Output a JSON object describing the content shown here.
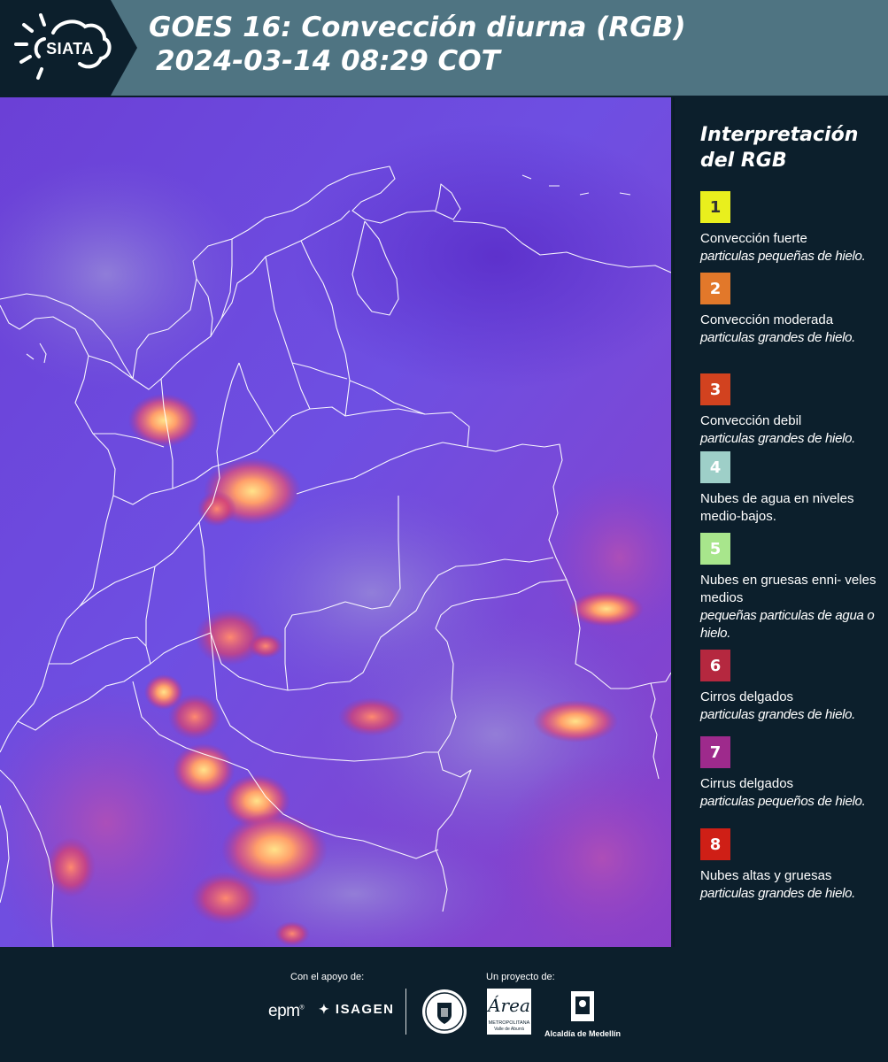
{
  "header": {
    "logo_text": "SIATA",
    "title_line1": "GOES 16: Convección diurna (RGB)",
    "title_line2": "2024-03-14 08:29 COT",
    "background_color": "#4f7482"
  },
  "map": {
    "description_icon": "satellite-rgb-map",
    "base_color": "#6a45d8"
  },
  "legend": {
    "title": "Interpretación del RGB",
    "items": [
      {
        "number": "1",
        "color": "#e9ef1d",
        "text_color": "#333333",
        "main": "Convección fuerte",
        "sub": "particulas pequeñas de hielo."
      },
      {
        "number": "2",
        "color": "#e2782a",
        "text_color": "#ffffff",
        "main": "Convección moderada",
        "sub": "particulas grandes de hielo."
      },
      {
        "number": "3",
        "color": "#d2421f",
        "text_color": "#ffffff",
        "main": "Convección debil",
        "sub": "particulas grandes de hielo."
      },
      {
        "number": "4",
        "color": "#9ecfc8",
        "text_color": "#ffffff",
        "main": "Nubes de agua en niveles medio-bajos.",
        "sub": ""
      },
      {
        "number": "5",
        "color": "#a8e68c",
        "text_color": "#ffffff",
        "main": "Nubes en gruesas enni- veles medios",
        "sub": "pequeñas particulas de agua o hielo."
      },
      {
        "number": "6",
        "color": "#b5283f",
        "text_color": "#ffffff",
        "main": "Cirros delgados",
        "sub": "particulas grandes de hielo."
      },
      {
        "number": "7",
        "color": "#9e2a8c",
        "text_color": "#ffffff",
        "main": "Cirrus delgados",
        "sub": "particulas pequeños de hielo."
      },
      {
        "number": "8",
        "color": "#cf1f16",
        "text_color": "#ffffff",
        "main": "Nubes altas y gruesas",
        "sub": "particulas grandes de hielo."
      }
    ]
  },
  "footer": {
    "support_label": "Con el apoyo de:",
    "project_label": "Un proyecto de:",
    "epm": "epm",
    "isagen": "ISAGEN",
    "area_text": "Área",
    "area_sub": "METROPOLITANA",
    "area_sub2": "Valle de Aburrá",
    "alcaldia": "Alcaldía de Medellín"
  }
}
